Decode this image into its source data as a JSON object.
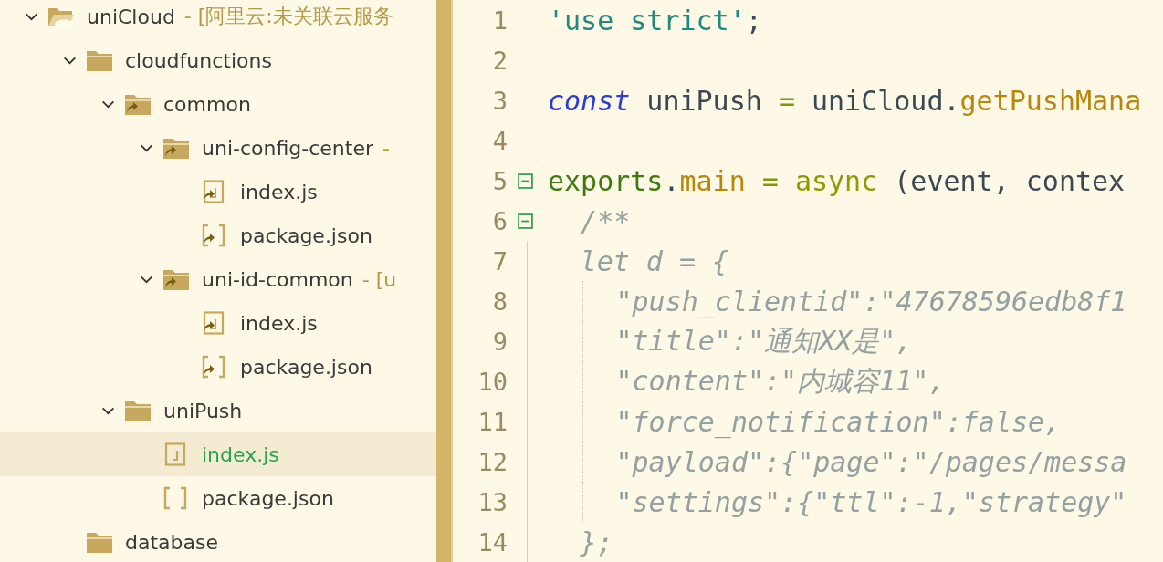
{
  "sidebar": {
    "tree": [
      {
        "label": "uniCloud",
        "suffix": "- [阿里云:未关联云服务",
        "kind": "cloud-folder",
        "expanded": true,
        "selected": false,
        "children": [
          {
            "label": "cloudfunctions",
            "kind": "folder",
            "expanded": true,
            "selected": false,
            "children": [
              {
                "label": "common",
                "kind": "linked-folder",
                "expanded": true,
                "selected": false,
                "children": [
                  {
                    "label": "uni-config-center",
                    "suffix": "-",
                    "kind": "linked-folder",
                    "expanded": true,
                    "selected": false,
                    "children": [
                      {
                        "label": "index.js",
                        "kind": "linked-js-file",
                        "selected": false
                      },
                      {
                        "label": "package.json",
                        "kind": "linked-json-file",
                        "selected": false
                      }
                    ]
                  },
                  {
                    "label": "uni-id-common",
                    "suffix": "- [u",
                    "kind": "linked-folder",
                    "expanded": true,
                    "selected": false,
                    "children": [
                      {
                        "label": "index.js",
                        "kind": "linked-js-file",
                        "selected": false
                      },
                      {
                        "label": "package.json",
                        "kind": "linked-json-file",
                        "selected": false
                      }
                    ]
                  }
                ]
              },
              {
                "label": "uniPush",
                "kind": "folder",
                "expanded": true,
                "selected": false,
                "children": [
                  {
                    "label": "index.js",
                    "kind": "js-file",
                    "selected": true
                  },
                  {
                    "label": "package.json",
                    "kind": "json-file",
                    "selected": false
                  }
                ]
              }
            ]
          },
          {
            "label": "database",
            "kind": "folder",
            "selected": false
          }
        ]
      }
    ]
  },
  "editor": {
    "lines": [
      {
        "number": "1",
        "tokens": [
          {
            "text": "'use strict'",
            "kind": "string"
          },
          {
            "text": ";",
            "kind": "plain"
          }
        ]
      },
      {
        "number": "2"
      },
      {
        "number": "3",
        "tokens": [
          {
            "text": "const",
            "kind": "storage"
          },
          {
            "text": " uniPush ",
            "kind": "plain"
          },
          {
            "text": "=",
            "kind": "operator"
          },
          {
            "text": " uniCloud.",
            "kind": "plain"
          },
          {
            "text": "getPushMana",
            "kind": "function"
          }
        ]
      },
      {
        "number": "4"
      },
      {
        "number": "5",
        "fold": true,
        "tokens": [
          {
            "text": "exports",
            "kind": "exports"
          },
          {
            "text": ".",
            "kind": "plain"
          },
          {
            "text": "main",
            "kind": "function"
          },
          {
            "text": " = ",
            "kind": "operator"
          },
          {
            "text": "async",
            "kind": "async"
          },
          {
            "text": " (event, contex",
            "kind": "plain"
          }
        ]
      },
      {
        "number": "6",
        "fold": true,
        "tokens": [
          {
            "text": "  /**",
            "kind": "comment"
          }
        ]
      },
      {
        "number": "7",
        "in_block": true,
        "tokens": [
          {
            "text": "  let d = {",
            "kind": "comment"
          }
        ]
      },
      {
        "number": "8",
        "in_block": true,
        "guide": true,
        "tokens": [
          {
            "text": "\"push_clientid\":\"47678596edb8f1",
            "kind": "comment"
          }
        ]
      },
      {
        "number": "9",
        "in_block": true,
        "guide": true,
        "tokens": [
          {
            "text": "\"title\":\"通知XX是\",",
            "kind": "comment"
          }
        ]
      },
      {
        "number": "10",
        "in_block": true,
        "guide": true,
        "tokens": [
          {
            "text": "\"content\":\"内城容11\",",
            "kind": "comment"
          }
        ]
      },
      {
        "number": "11",
        "in_block": true,
        "guide": true,
        "tokens": [
          {
            "text": "\"force_notification\":false,",
            "kind": "comment"
          }
        ]
      },
      {
        "number": "12",
        "in_block": true,
        "guide": true,
        "tokens": [
          {
            "text": "\"payload\":{\"page\":\"/pages/messa",
            "kind": "comment"
          }
        ]
      },
      {
        "number": "13",
        "in_block": true,
        "guide": true,
        "tokens": [
          {
            "text": "\"settings\":{\"ttl\":-1,\"strategy\"",
            "kind": "comment"
          }
        ]
      },
      {
        "number": "14",
        "in_block": true,
        "tokens": [
          {
            "text": "  };",
            "kind": "comment"
          }
        ]
      }
    ]
  }
}
